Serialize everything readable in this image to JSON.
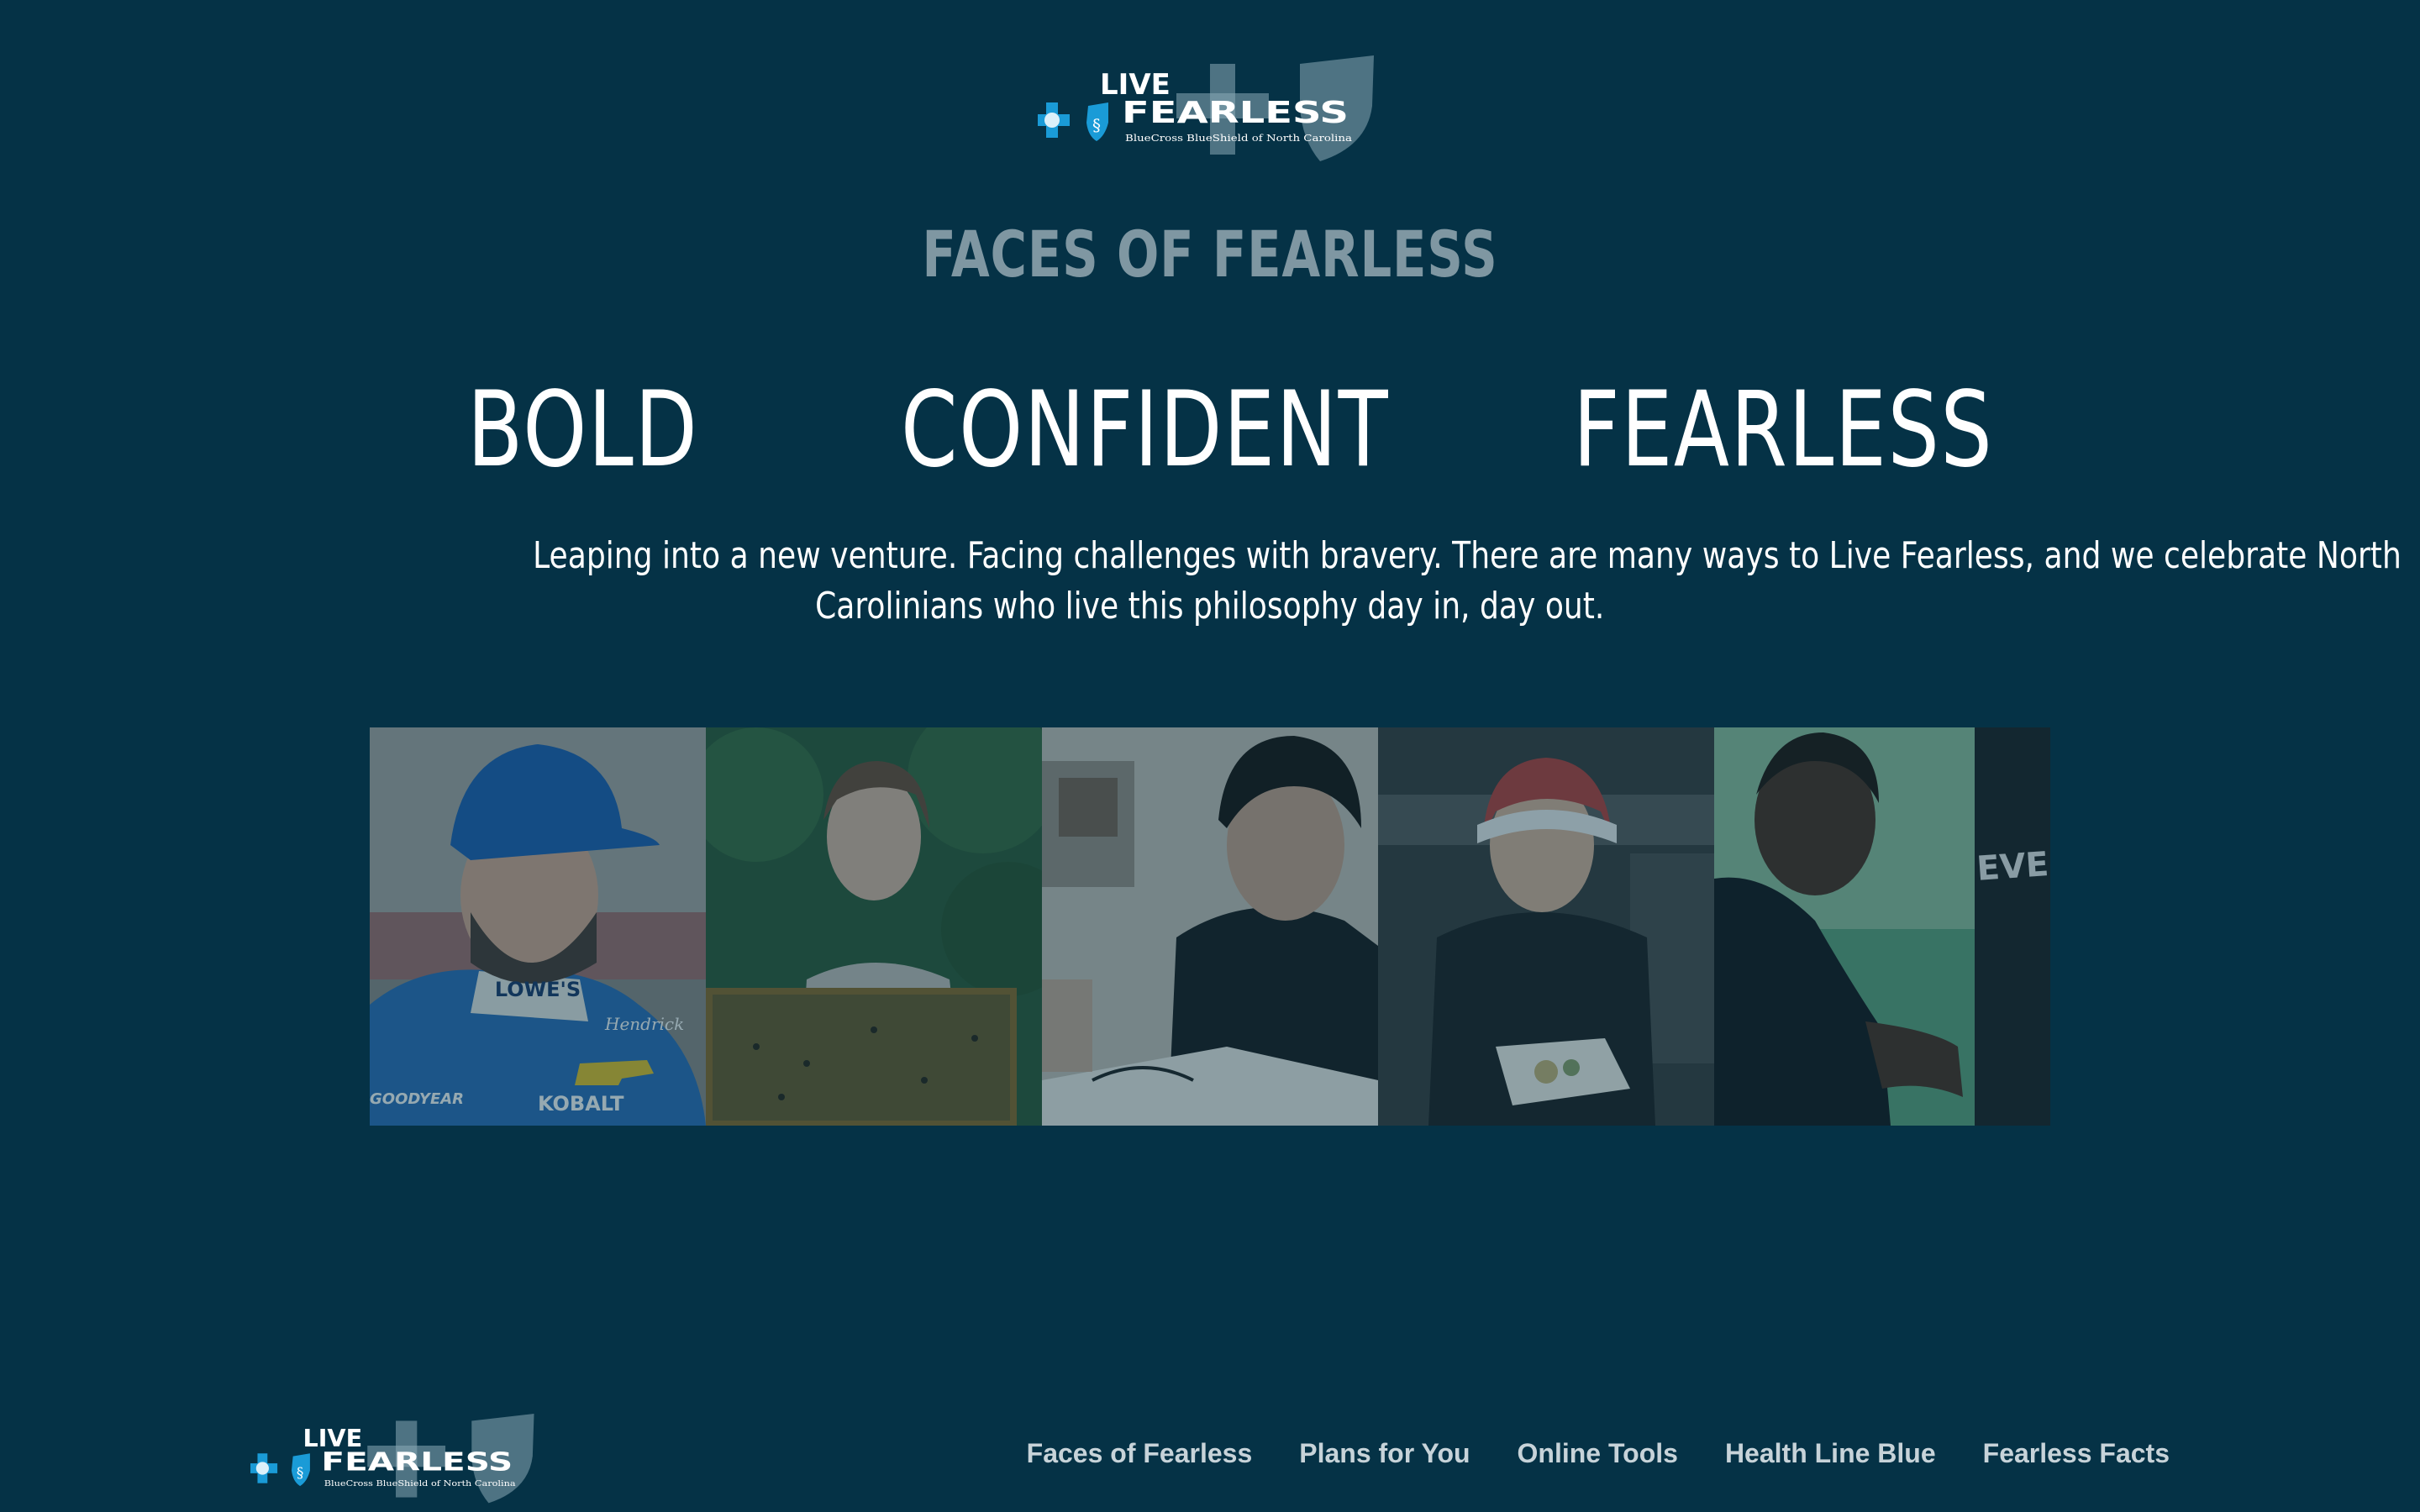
{
  "header": {
    "logo": {
      "top_line": "LIVE",
      "bottom_line": "FEARLESS",
      "company": "BlueCross BlueShield of North Carolina"
    }
  },
  "main": {
    "title": "FACES OF FEARLESS",
    "traits": [
      "BOLD",
      "CONFIDENT",
      "FEARLESS"
    ],
    "intro_line1": "Leaping into a new venture. Facing challenges with bravery. There are many ways to Live Fearless, and we celebrate North",
    "intro_line2": "Carolinians who live this philosophy day in, day out.",
    "photo_text": {
      "racer_collar": "LOWE'S",
      "racer_chest": "Hendrick",
      "racer_sponsor": "KOBALT",
      "racer_tire": "GOODYEAR",
      "boxer_bag": "EVERLAST"
    }
  },
  "footer": {
    "logo": {
      "top_line": "LIVE",
      "bottom_line": "FEARLESS",
      "company": "BlueCross BlueShield of North Carolina"
    },
    "nav": [
      "Faces of Fearless",
      "Plans for You",
      "Online Tools",
      "Health Line Blue",
      "Fearless Facts"
    ]
  },
  "colors": {
    "background": "#053246",
    "brand_blue": "#1a9bd7",
    "title_gray": "#7f97a2",
    "nav_text": "#c7d3d9"
  }
}
